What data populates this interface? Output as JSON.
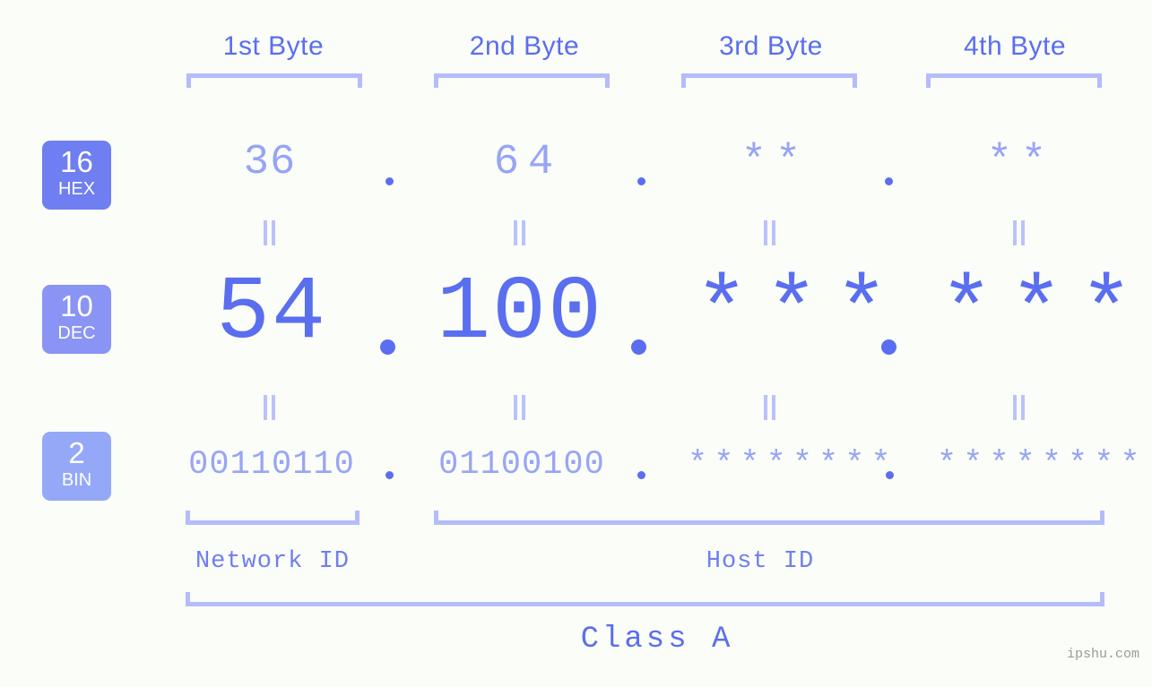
{
  "watermark": "ipshu.com",
  "headers": [
    {
      "label": "1st Byte"
    },
    {
      "label": "2nd Byte"
    },
    {
      "label": "3rd Byte"
    },
    {
      "label": "4th Byte"
    }
  ],
  "bases": [
    {
      "number": "16",
      "name": "HEX",
      "color": "#6f7ef0"
    },
    {
      "number": "10",
      "name": "DEC",
      "color": "#8994f5"
    },
    {
      "number": "2",
      "name": "BIN",
      "color": "#94a8f7"
    }
  ],
  "rows": {
    "hex": {
      "base": "16",
      "name": "HEX",
      "values": [
        "36",
        "64",
        "**",
        "**"
      ]
    },
    "dec": {
      "base": "10",
      "name": "DEC",
      "values": [
        "54",
        "100",
        "***",
        "***"
      ]
    },
    "bin": {
      "base": "2",
      "name": "BIN",
      "values": [
        "00110110",
        "01100100",
        "********",
        "********"
      ]
    }
  },
  "separators": {
    "hex": [
      ".",
      ".",
      "."
    ],
    "dec": [
      ".",
      ".",
      "."
    ],
    "bin": [
      ".",
      ".",
      "."
    ]
  },
  "connectors": {
    "symbol": "=",
    "hex_to_dec": [
      "=",
      "=",
      "=",
      "="
    ],
    "dec_to_bin": [
      "=",
      "=",
      "=",
      "="
    ]
  },
  "regions": [
    {
      "label": "Network ID",
      "bytes": "1"
    },
    {
      "label": "Host ID",
      "bytes": "2-4"
    }
  ],
  "class": {
    "label": "Class A"
  },
  "colors": {
    "background": "#fbfdf8",
    "accent_strong": "#5a6ef0",
    "accent_mid": "#8994f5",
    "accent_light": "#b4bcfa",
    "watermark": "#9b9b9b"
  }
}
